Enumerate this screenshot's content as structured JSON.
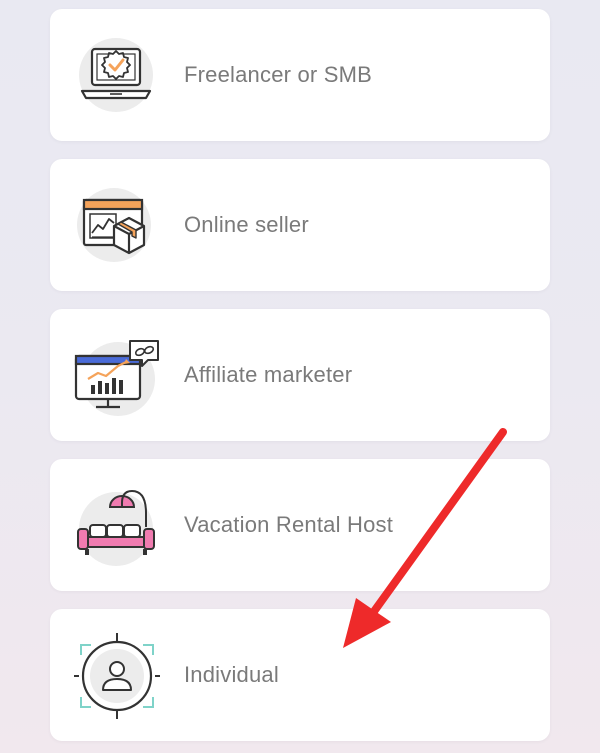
{
  "options": [
    {
      "label": "Freelancer or SMB",
      "icon": "laptop-badge-icon"
    },
    {
      "label": "Online seller",
      "icon": "shop-box-icon"
    },
    {
      "label": "Affiliate marketer",
      "icon": "monitor-chart-icon"
    },
    {
      "label": "Vacation Rental Host",
      "icon": "sofa-lamp-icon"
    },
    {
      "label": "Individual",
      "icon": "user-target-icon"
    }
  ],
  "colors": {
    "card_bg": "#ffffff",
    "label": "#7a7a7a",
    "accent_orange": "#f5a35a",
    "accent_pink": "#f07bb0",
    "accent_teal": "#7fd3c9",
    "accent_blue": "#4a6bd8",
    "annotation_arrow": "#ee2a2a"
  }
}
